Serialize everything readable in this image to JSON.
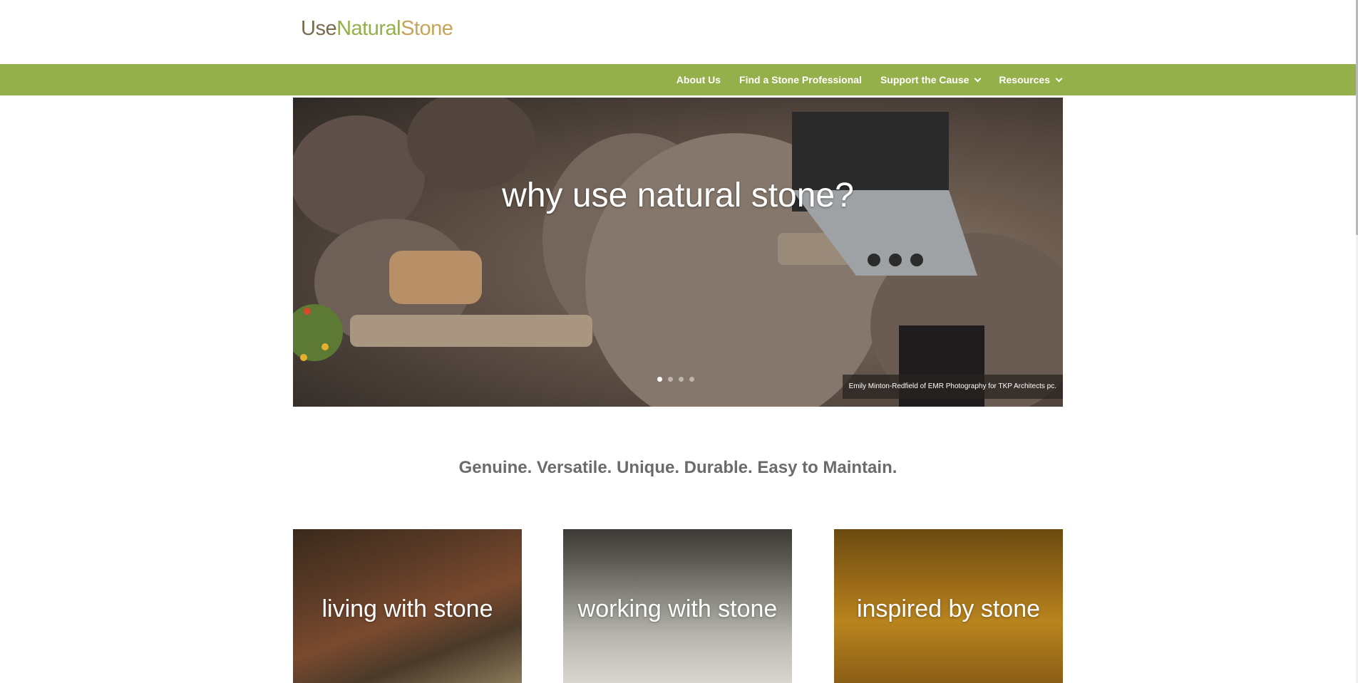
{
  "logo": {
    "part1": "Use",
    "part2": "Natural",
    "part3": "Stone"
  },
  "nav": {
    "about": "About Us",
    "find": "Find a Stone Professional",
    "support": "Support the Cause",
    "resources": "Resources"
  },
  "hero": {
    "title": "why use natural stone?",
    "credit": "Emily Minton-Redfield of EMR Photography for TKP Architects pc.",
    "slide_count": 4,
    "active_slide": 1
  },
  "tagline": "Genuine. Versatile. Unique. Durable. Easy to Maintain.",
  "tiles": [
    {
      "label": "living with stone"
    },
    {
      "label": "working with stone"
    },
    {
      "label": "inspired by stone"
    }
  ],
  "colors": {
    "nav_green": "#94b04a",
    "logo_brown": "#7a6a50",
    "logo_green": "#94b04a",
    "logo_gold": "#c8a35a"
  }
}
